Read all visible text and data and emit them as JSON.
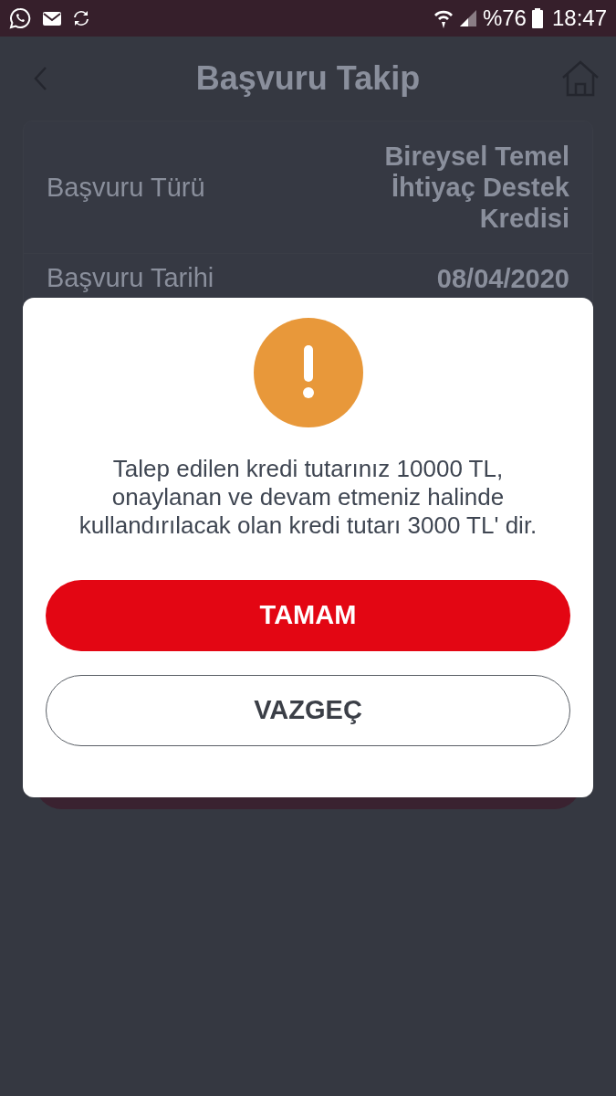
{
  "status_bar": {
    "battery_text": "%76",
    "time": "18:47"
  },
  "header": {
    "title": "Başvuru Takip"
  },
  "details": [
    {
      "label": "Başvuru Türü",
      "value": "Bireysel Temel İhtiyaç Destek Kredisi"
    },
    {
      "label": "Başvuru Tarihi",
      "value": "08/04/2020"
    }
  ],
  "dialog": {
    "message": "Talep edilen kredi tutarınız 10000 TL, onaylanan ve devam etmeniz halinde kullandırılacak olan kredi tutarı 3000 TL' dir.",
    "buttons": [
      {
        "label": "TAMAM",
        "kind": "primary"
      },
      {
        "label": "VAZGEÇ",
        "kind": "secondary"
      }
    ]
  }
}
